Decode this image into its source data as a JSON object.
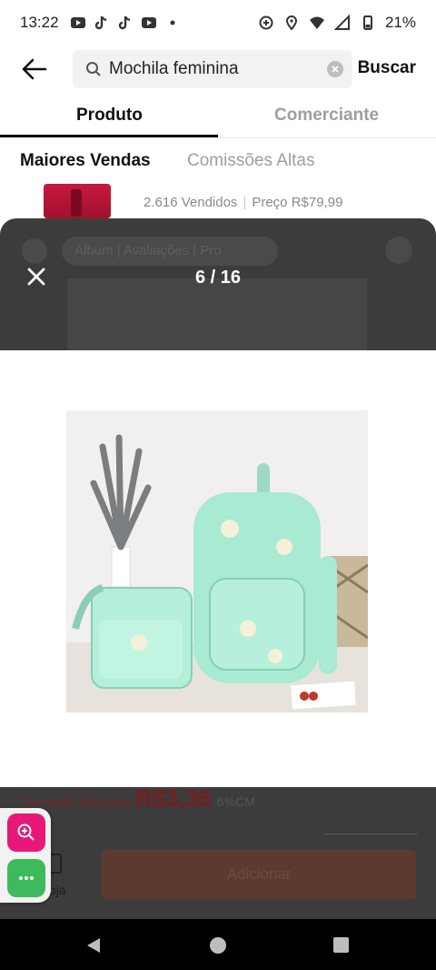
{
  "status_bar": {
    "time": "13:22",
    "battery": "21%",
    "notification_icons": [
      "youtube-icon",
      "tiktok-icon",
      "tiktok-icon",
      "youtube-icon",
      "dot-icon"
    ]
  },
  "search": {
    "query": "Mochila feminina",
    "submit_label": "Buscar"
  },
  "tabs": [
    {
      "label": "Produto",
      "active": true
    },
    {
      "label": "Comerciante",
      "active": false
    }
  ],
  "subtabs": [
    {
      "label": "Maiores Vendas",
      "active": true
    },
    {
      "label": "Comissões Altas",
      "active": false
    }
  ],
  "product_peek": {
    "sold": "2.616 Vendidos",
    "price": "Preço R$79,99"
  },
  "viewer": {
    "counter": "6 / 16"
  },
  "background": {
    "chip_text": "Álbum  |  Avaliações  |  Pro",
    "commission_label": "Comissão estimada",
    "commission_value": "R$3,36",
    "commission_pct": "6%CM",
    "store_label": "Loja",
    "add_button": "Adicionar"
  },
  "colors": {
    "overlay": "#3c3c3c",
    "fab_zoom": "#e8177a",
    "fab_more": "#3dbb5c",
    "navbar": "#000000"
  }
}
